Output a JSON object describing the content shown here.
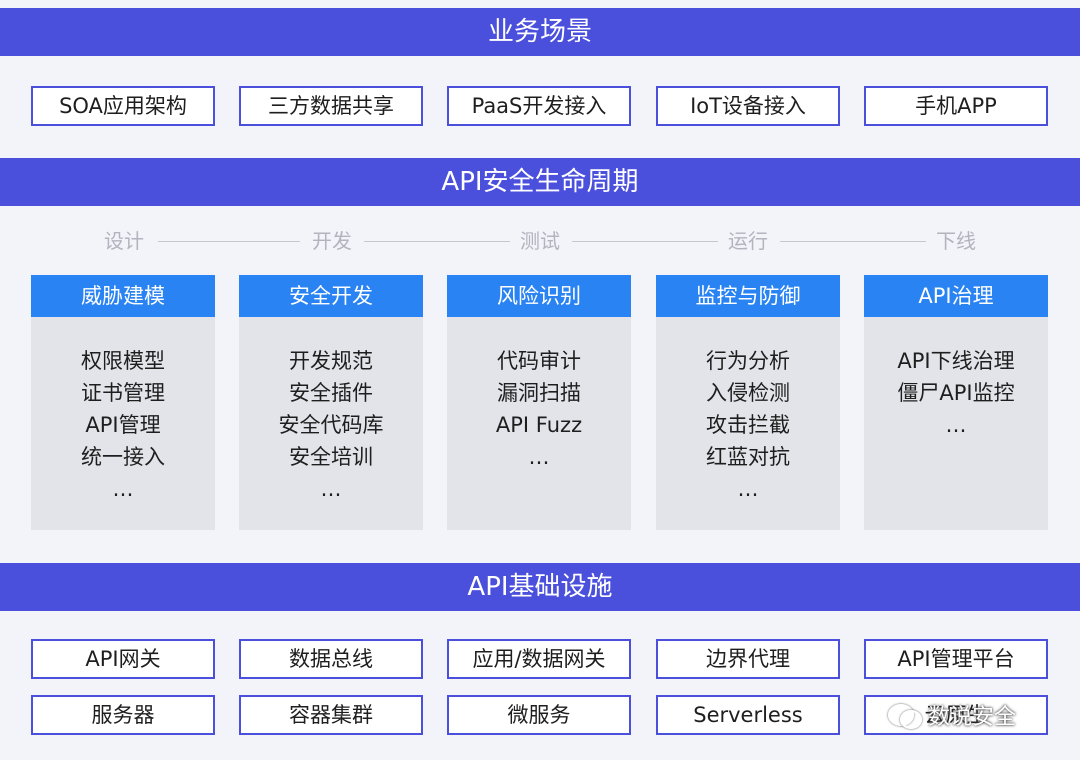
{
  "sections": {
    "business": "业务场景",
    "lifecycle": "API安全生命周期",
    "infra": "API基础设施"
  },
  "business_scenarios": [
    "SOA应用架构",
    "三方数据共享",
    "PaaS开发接入",
    "IoT设备接入",
    "手机APP"
  ],
  "stages": [
    "设计",
    "开发",
    "测试",
    "运行",
    "下线"
  ],
  "columns": [
    {
      "title": "威胁建模",
      "items": [
        "权限模型",
        "证书管理",
        "API管理",
        "统一接入",
        "…"
      ]
    },
    {
      "title": "安全开发",
      "items": [
        "开发规范",
        "安全插件",
        "安全代码库",
        "安全培训",
        "…"
      ]
    },
    {
      "title": "风险识别",
      "items": [
        "代码审计",
        "漏洞扫描",
        "API Fuzz",
        "…"
      ]
    },
    {
      "title": "监控与防御",
      "items": [
        "行为分析",
        "入侵检测",
        "攻击拦截",
        "红蓝对抗",
        "…"
      ]
    },
    {
      "title": "API治理",
      "items": [
        "API下线治理",
        "僵尸API监控",
        "…"
      ]
    }
  ],
  "infrastructure": {
    "row1": [
      "API网关",
      "数据总线",
      "应用/数据网关",
      "边界代理",
      "API管理平台"
    ],
    "row2": [
      "服务器",
      "容器集群",
      "微服务",
      "Serverless",
      "云原生"
    ]
  },
  "watermark": {
    "text": "数说安全",
    "icon": "wechat-icon"
  },
  "colors": {
    "banner": "#4a4fdc",
    "column_header": "#2a83f3",
    "background": "#f3f4f9"
  }
}
